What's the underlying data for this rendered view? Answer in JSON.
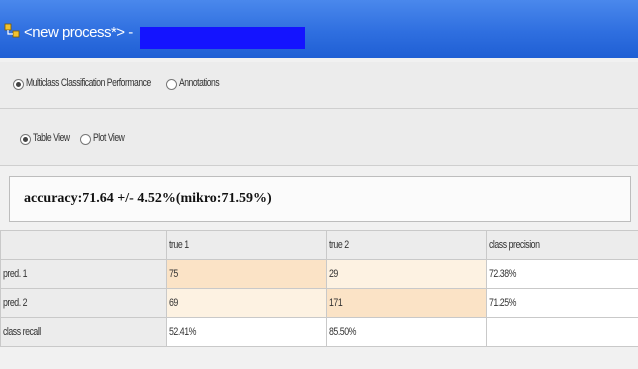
{
  "window": {
    "title": "<new process*> -",
    "highlight_color": "#1414ff",
    "titlebar_color": "#2f6fe0"
  },
  "view_selector": {
    "options": [
      {
        "label": "Multiclass Classification Performance",
        "selected": true
      },
      {
        "label": "Annotations",
        "selected": false
      }
    ]
  },
  "display_mode": {
    "options": [
      {
        "label": "Table View",
        "selected": true
      },
      {
        "label": "Plot View",
        "selected": false
      }
    ]
  },
  "toolbar": {
    "icons": [
      "printer-icon",
      "export-icon"
    ]
  },
  "result": {
    "accuracy_text": "accuracy:71.64 +/- 4.52%(mikro:71.59%)"
  },
  "confusion_matrix": {
    "headers": [
      "",
      "true 1",
      "true 2",
      "class precision"
    ],
    "rows": [
      {
        "label": "pred. 1",
        "cells": [
          "75",
          "29",
          "72.38%"
        ]
      },
      {
        "label": "pred. 2",
        "cells": [
          "69",
          "171",
          "71.25%"
        ]
      },
      {
        "label": "class recall",
        "cells": [
          "52.41%",
          "85.50%",
          ""
        ]
      }
    ],
    "highlight_colors": {
      "strong": "#fbe3c6",
      "light": "#fdf2e2"
    }
  }
}
